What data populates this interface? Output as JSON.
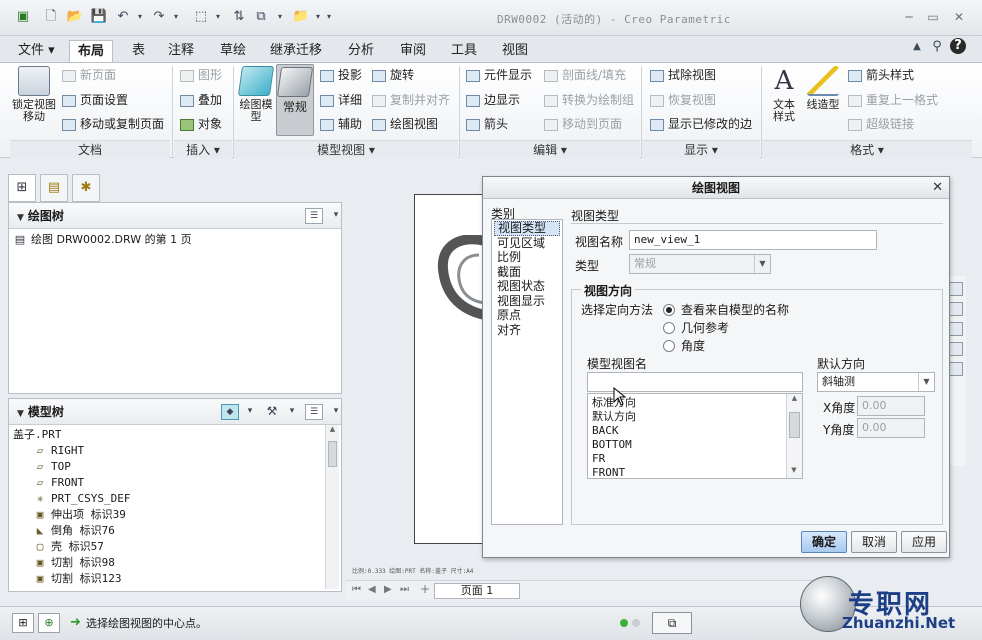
{
  "window": {
    "title": "DRW0002 (活动的) - Creo Parametric",
    "controls": [
      "─",
      "▭",
      "✕"
    ]
  },
  "quick_access": [
    "▣",
    "🗋",
    "📂",
    "💾",
    "↶",
    "▾",
    "↷",
    "▾",
    "⬚",
    "▾",
    "⇅",
    "⧉",
    "▾",
    "📁",
    "▾",
    "▾"
  ],
  "ribbon": {
    "tabs": [
      "文件 ▾",
      "布局",
      "表",
      "注释",
      "草绘",
      "继承迁移",
      "分析",
      "审阅",
      "工具",
      "视图"
    ],
    "right_icons": [
      "▲",
      "⚲",
      "?"
    ],
    "doc": {
      "lock_view": "锁定视图移动",
      "new_page": "新页面",
      "page_setup": "页面设置",
      "move_copy": "移动或复制页面",
      "group": "文档"
    },
    "insert": {
      "graphics": "图形",
      "overlay": "叠加",
      "object": "对象",
      "group": "插入 ▾"
    },
    "model_views": {
      "drawing_model": "绘图模型",
      "general": "常规",
      "projection": "投影",
      "detail": "详细",
      "auxiliary": "辅助",
      "rotate": "旋转",
      "copy_align": "复制并对齐",
      "drawing_view": "绘图视图",
      "group": "模型视图 ▾"
    },
    "edit": {
      "element_display": "元件显示",
      "edge_display": "边显示",
      "arrow": "箭头",
      "section_line_fill": "剖面线/填充",
      "convert_to_sketch_group": "转换为绘制组",
      "move_to_page": "移动到页面",
      "group": "编辑 ▾"
    },
    "display": {
      "erase_view": "拭除视图",
      "resume_view": "恢复视图",
      "show_modified_edges": "显示已修改的边",
      "group": "显示 ▾"
    },
    "format": {
      "text_style": "文本样式",
      "line_style": "线造型",
      "arrow_style": "箭头样式",
      "repeat_format": "重复上一格式",
      "hyperlink": "超级链接",
      "group": "格式 ▾"
    }
  },
  "left_panel": {
    "tab_icons": [
      "⊞",
      "▤",
      "✱"
    ],
    "drawing_tree": {
      "title": "绘图树",
      "items": [
        "绘图 DRW0002.DRW 的第 1 页"
      ]
    },
    "model_tree": {
      "title": "模型树",
      "root": "盖子.PRT",
      "items": [
        {
          "icon": "▱",
          "label": "RIGHT"
        },
        {
          "icon": "▱",
          "label": "TOP"
        },
        {
          "icon": "▱",
          "label": "FRONT"
        },
        {
          "icon": "✳",
          "label": "PRT_CSYS_DEF"
        },
        {
          "icon": "▣",
          "label": "伸出项 标识39"
        },
        {
          "icon": "◣",
          "label": "倒角 标识76"
        },
        {
          "icon": "▢",
          "label": "壳 标识57"
        },
        {
          "icon": "▣",
          "label": "切割 标识98"
        },
        {
          "icon": "▣",
          "label": "切割 标识123"
        }
      ]
    }
  },
  "canvas": {
    "sheet_info": "比例:0.333  绘图:PRT  名称:盖子  尺寸:A4",
    "page_label": "页面 1",
    "page_nav": [
      "⏮",
      "◀",
      "▶",
      "⏭"
    ],
    "add_page": "+"
  },
  "dialog": {
    "title": "绘图视图",
    "close": "✕",
    "category_label": "类别",
    "categories": [
      "视图类型",
      "可见区域",
      "比例",
      "截面",
      "视图状态",
      "视图显示",
      "原点",
      "对齐"
    ],
    "selected_category": "视图类型",
    "section_title": "视图类型",
    "view_name_label": "视图名称",
    "view_name_value": "new_view_1",
    "type_label": "类型",
    "type_value": "常规",
    "orientation_group": "视图方向",
    "orientation_method_label": "选择定向方法",
    "orientation_options": [
      "查看来自模型的名称",
      "几何参考",
      "角度"
    ],
    "orientation_selected": 0,
    "model_view_name_label": "模型视图名",
    "model_view_search": "",
    "model_views": [
      "标准方向",
      "默认方向",
      "BACK",
      "BOTTOM",
      "FR",
      "FRONT"
    ],
    "default_orientation_label": "默认方向",
    "default_orientation_value": "斜轴测",
    "x_angle_label": "X角度",
    "x_angle_value": "0.00",
    "y_angle_label": "Y角度",
    "y_angle_value": "0.00",
    "buttons": {
      "ok": "确定",
      "cancel": "取消",
      "apply": "应用"
    }
  },
  "status": {
    "message": "选择绘图视图的中心点。",
    "filter_icon": "⧉"
  },
  "watermark": {
    "text": "专职网",
    "url": "Zhuanzhi.Net"
  }
}
